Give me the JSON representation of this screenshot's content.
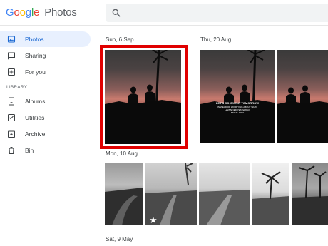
{
  "header": {
    "logo_g": "Google",
    "logo_photos": "Photos"
  },
  "sidebar": {
    "items": [
      {
        "label": "Photos",
        "icon": "photos-icon",
        "active": true
      },
      {
        "label": "Sharing",
        "icon": "sharing-icon",
        "active": false
      },
      {
        "label": "For you",
        "icon": "for-you-icon",
        "active": false
      }
    ],
    "library_label": "LIBRARY",
    "library_items": [
      {
        "label": "Albums",
        "icon": "albums-icon"
      },
      {
        "label": "Utilities",
        "icon": "utilities-icon"
      },
      {
        "label": "Archive",
        "icon": "archive-icon"
      },
      {
        "label": "Bin",
        "icon": "bin-icon"
      }
    ]
  },
  "groups": [
    {
      "date": "Sun, 6 Sep"
    },
    {
      "date": "Thu, 20 Aug"
    },
    {
      "date": "Mon, 10 Aug"
    },
    {
      "date": "Sat, 9 May"
    }
  ],
  "overlay": {
    "line1": "LET'S GO INVENT TOMORROW",
    "line2": "INSTEAD OF WORRYING ABOUT WHAT",
    "line3": "HAPPENED YESTERDAY",
    "line4": "STEVE JOBS"
  },
  "colors": {
    "accent": "#1a73e8",
    "selection": "#e00000",
    "active_bg": "#e8f0fe"
  }
}
